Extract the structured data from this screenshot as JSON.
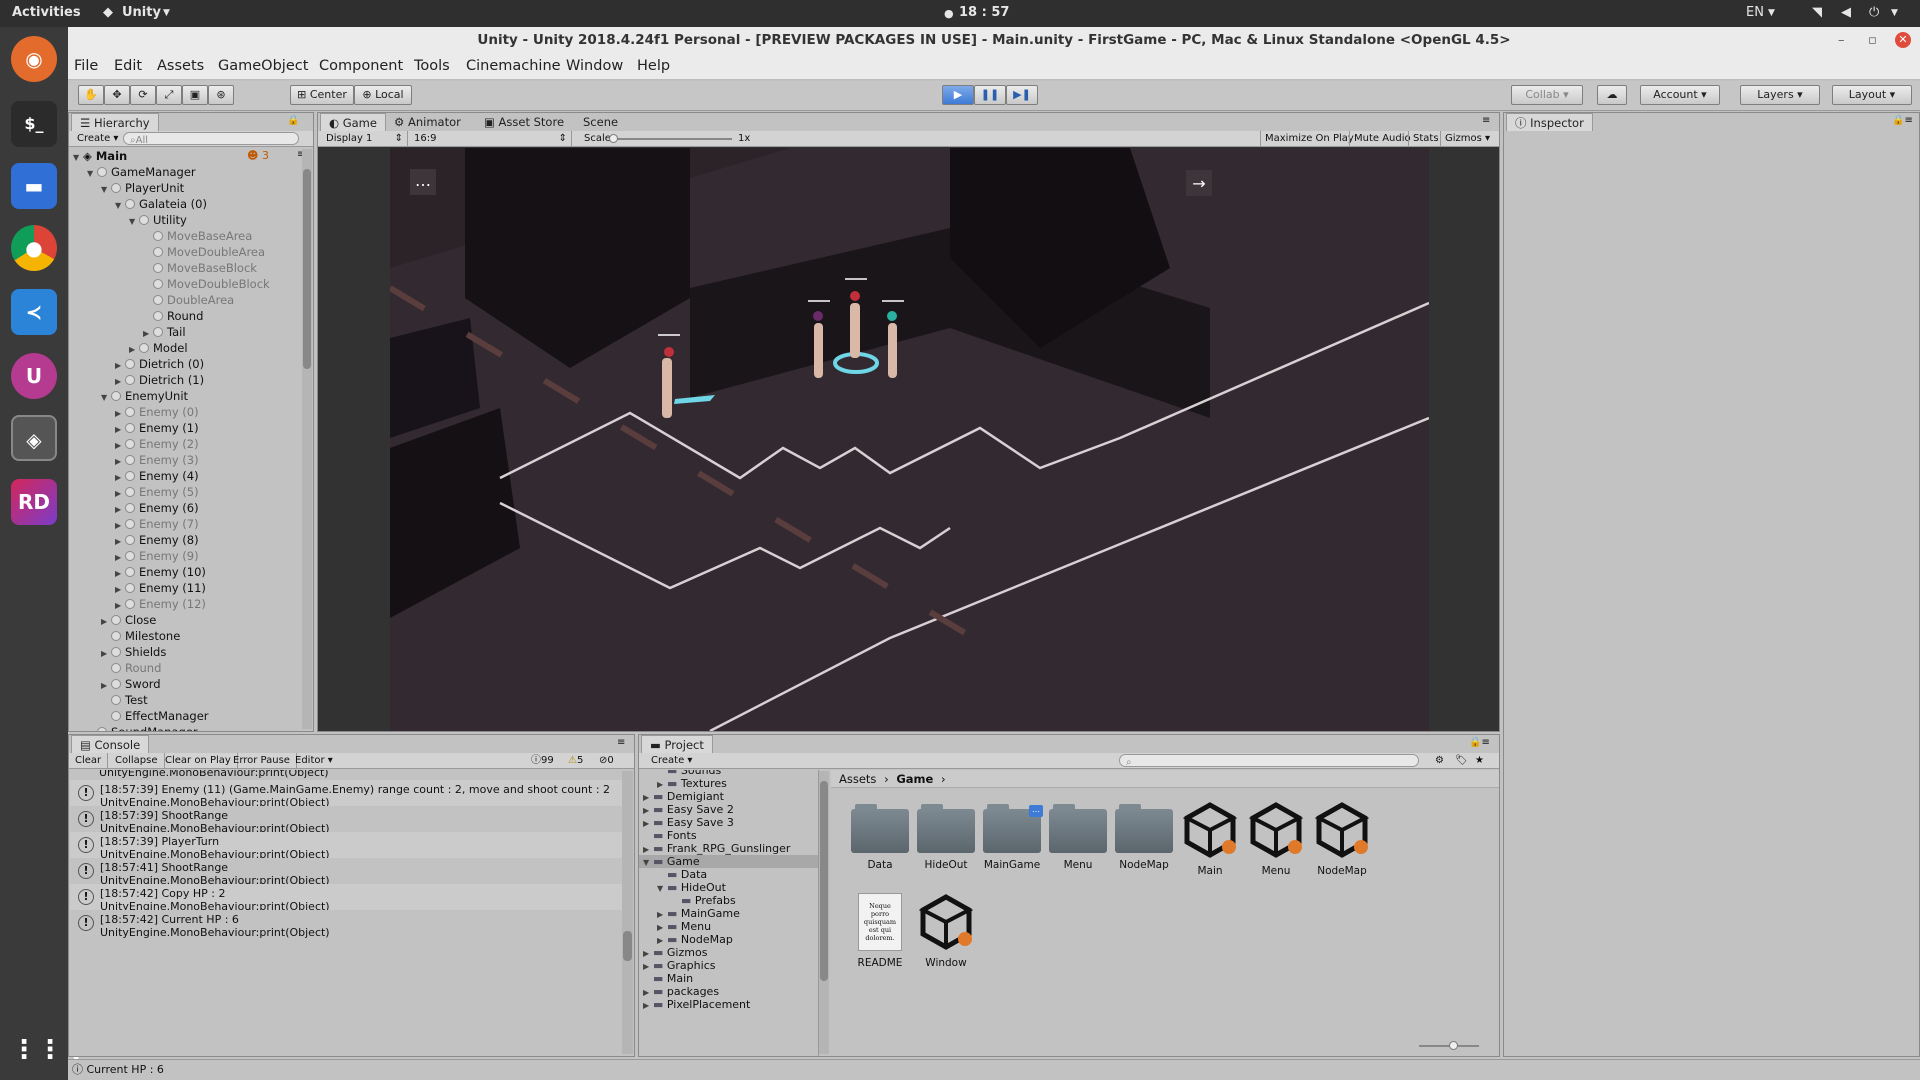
{
  "system": {
    "activities": "Activities",
    "app_menu": "Unity",
    "clock": "18 : 57",
    "lang": "EN"
  },
  "window": {
    "title": "Unity - Unity 2018.4.24f1 Personal - [PREVIEW PACKAGES IN USE] - Main.unity - FirstGame - PC, Mac & Linux Standalone <OpenGL 4.5>"
  },
  "menu": [
    "File",
    "Edit",
    "Assets",
    "GameObject",
    "Component",
    "Tools",
    "Cinemachine",
    "Window",
    "Help"
  ],
  "toolbar": {
    "center": "Center",
    "local": "Local",
    "collab": "Collab",
    "account": "Account",
    "layers": "Layers",
    "layout": "Layout"
  },
  "hierarchy": {
    "tab": "Hierarchy",
    "create": "Create",
    "search_placeholder": "All",
    "scene": "Main",
    "badge": "3",
    "items": [
      {
        "label": "GameManager",
        "depth": 1,
        "arrow": "down",
        "dim": false
      },
      {
        "label": "PlayerUnit",
        "depth": 2,
        "arrow": "down",
        "dim": false
      },
      {
        "label": "Galateia (0)",
        "depth": 3,
        "arrow": "down",
        "dim": false
      },
      {
        "label": "Utility",
        "depth": 4,
        "arrow": "down",
        "dim": false
      },
      {
        "label": "MoveBaseArea",
        "depth": 5,
        "arrow": "",
        "dim": true
      },
      {
        "label": "MoveDoubleArea",
        "depth": 5,
        "arrow": "",
        "dim": true
      },
      {
        "label": "MoveBaseBlock",
        "depth": 5,
        "arrow": "",
        "dim": true
      },
      {
        "label": "MoveDoubleBlock",
        "depth": 5,
        "arrow": "",
        "dim": true
      },
      {
        "label": "DoubleArea",
        "depth": 5,
        "arrow": "",
        "dim": true
      },
      {
        "label": "Round",
        "depth": 5,
        "arrow": "",
        "dim": false
      },
      {
        "label": "Tail",
        "depth": 5,
        "arrow": "right",
        "dim": false
      },
      {
        "label": "Model",
        "depth": 4,
        "arrow": "right",
        "dim": false
      },
      {
        "label": "Dietrich (0)",
        "depth": 3,
        "arrow": "right",
        "dim": false
      },
      {
        "label": "Dietrich (1)",
        "depth": 3,
        "arrow": "right",
        "dim": false
      },
      {
        "label": "EnemyUnit",
        "depth": 2,
        "arrow": "down",
        "dim": false
      },
      {
        "label": "Enemy (0)",
        "depth": 3,
        "arrow": "right",
        "dim": true
      },
      {
        "label": "Enemy (1)",
        "depth": 3,
        "arrow": "right",
        "dim": false
      },
      {
        "label": "Enemy (2)",
        "depth": 3,
        "arrow": "right",
        "dim": true
      },
      {
        "label": "Enemy (3)",
        "depth": 3,
        "arrow": "right",
        "dim": true
      },
      {
        "label": "Enemy (4)",
        "depth": 3,
        "arrow": "right",
        "dim": false
      },
      {
        "label": "Enemy (5)",
        "depth": 3,
        "arrow": "right",
        "dim": true
      },
      {
        "label": "Enemy (6)",
        "depth": 3,
        "arrow": "right",
        "dim": false
      },
      {
        "label": "Enemy (7)",
        "depth": 3,
        "arrow": "right",
        "dim": true
      },
      {
        "label": "Enemy (8)",
        "depth": 3,
        "arrow": "right",
        "dim": false
      },
      {
        "label": "Enemy (9)",
        "depth": 3,
        "arrow": "right",
        "dim": true
      },
      {
        "label": "Enemy (10)",
        "depth": 3,
        "arrow": "right",
        "dim": false
      },
      {
        "label": "Enemy (11)",
        "depth": 3,
        "arrow": "right",
        "dim": false
      },
      {
        "label": "Enemy (12)",
        "depth": 3,
        "arrow": "right",
        "dim": true
      },
      {
        "label": "Close",
        "depth": 2,
        "arrow": "right",
        "dim": false
      },
      {
        "label": "Milestone",
        "depth": 2,
        "arrow": "",
        "dim": false
      },
      {
        "label": "Shields",
        "depth": 2,
        "arrow": "right",
        "dim": false
      },
      {
        "label": "Round",
        "depth": 2,
        "arrow": "",
        "dim": true
      },
      {
        "label": "Sword",
        "depth": 2,
        "arrow": "right",
        "dim": false
      },
      {
        "label": "Test",
        "depth": 2,
        "arrow": "",
        "dim": false
      },
      {
        "label": "EffectManager",
        "depth": 2,
        "arrow": "",
        "dim": false
      },
      {
        "label": "SoundManager",
        "depth": 1,
        "arrow": "right",
        "dim": false
      }
    ]
  },
  "game": {
    "tabs": [
      "Game",
      "Animator",
      "Asset Store",
      "Scene"
    ],
    "display": "Display 1",
    "aspect": "16:9",
    "scale_label": "Scale",
    "scale_value": "1x",
    "options": [
      "Maximize On Play",
      "Mute Audio",
      "Stats",
      "Gizmos"
    ]
  },
  "inspector": {
    "tab": "Inspector"
  },
  "console": {
    "tab": "Console",
    "buttons": [
      "Clear",
      "Collapse",
      "Clear on Play",
      "Error Pause",
      "Editor"
    ],
    "counts": {
      "info": "99",
      "warn": "5",
      "error": "0"
    },
    "partial": "UnityEngine.MonoBehaviour:print(Object)",
    "entries": [
      {
        "line1": "[18:57:39] Enemy (11) (Game.MainGame.Enemy) range count : 2, move and shoot count : 2",
        "line2": "UnityEngine.MonoBehaviour:print(Object)"
      },
      {
        "line1": "[18:57:39] ShootRange",
        "line2": "UnityEngine.MonoBehaviour:print(Object)"
      },
      {
        "line1": "[18:57:39] PlayerTurn",
        "line2": "UnityEngine.MonoBehaviour:print(Object)"
      },
      {
        "line1": "[18:57:41] ShootRange",
        "line2": "UnityEngine.MonoBehaviour:print(Object)"
      },
      {
        "line1": "[18:57:42] Copy HP : 2",
        "line2": "UnityEngine.MonoBehaviour:print(Object)"
      },
      {
        "line1": "[18:57:42] Current HP : 6",
        "line2": "UnityEngine.MonoBehaviour:print(Object)"
      }
    ]
  },
  "project": {
    "tab": "Project",
    "create": "Create",
    "breadcrumb": [
      "Assets",
      "Game"
    ],
    "tree": [
      {
        "label": "Sounds",
        "depth": 2,
        "arrow": ""
      },
      {
        "label": "Textures",
        "depth": 2,
        "arrow": "right"
      },
      {
        "label": "Demigiant",
        "depth": 1,
        "arrow": "right"
      },
      {
        "label": "Easy Save 2",
        "depth": 1,
        "arrow": "right"
      },
      {
        "label": "Easy Save 3",
        "depth": 1,
        "arrow": "right"
      },
      {
        "label": "Fonts",
        "depth": 1,
        "arrow": ""
      },
      {
        "label": "Frank_RPG_Gunslinger",
        "depth": 1,
        "arrow": "right"
      },
      {
        "label": "Game",
        "depth": 1,
        "arrow": "down",
        "selected": true
      },
      {
        "label": "Data",
        "depth": 2,
        "arrow": ""
      },
      {
        "label": "HideOut",
        "depth": 2,
        "arrow": "down"
      },
      {
        "label": "Prefabs",
        "depth": 3,
        "arrow": ""
      },
      {
        "label": "MainGame",
        "depth": 2,
        "arrow": "right"
      },
      {
        "label": "Menu",
        "depth": 2,
        "arrow": "right"
      },
      {
        "label": "NodeMap",
        "depth": 2,
        "arrow": "right"
      },
      {
        "label": "Gizmos",
        "depth": 1,
        "arrow": "right"
      },
      {
        "label": "Graphics",
        "depth": 1,
        "arrow": "right"
      },
      {
        "label": "Main",
        "depth": 1,
        "arrow": ""
      },
      {
        "label": "packages",
        "depth": 1,
        "arrow": "right"
      },
      {
        "label": "PixelPlacement",
        "depth": 1,
        "arrow": "right"
      }
    ],
    "assets": [
      {
        "label": "Data",
        "kind": "folder"
      },
      {
        "label": "HideOut",
        "kind": "folder"
      },
      {
        "label": "MainGame",
        "kind": "folder"
      },
      {
        "label": "Menu",
        "kind": "folder"
      },
      {
        "label": "NodeMap",
        "kind": "folder"
      },
      {
        "label": "Main",
        "kind": "unity"
      },
      {
        "label": "Menu",
        "kind": "unity"
      },
      {
        "label": "NodeMap",
        "kind": "unity"
      },
      {
        "label": "README",
        "kind": "doc"
      },
      {
        "label": "Window",
        "kind": "unity"
      }
    ],
    "readme_preview": "Neque porro quisquam est qui dolorem."
  },
  "status": {
    "text": "Current HP : 6"
  },
  "colors": {
    "accent": "#3d7bd6",
    "dark_scene": "#2a2228",
    "selected": "#a8a8a8"
  }
}
